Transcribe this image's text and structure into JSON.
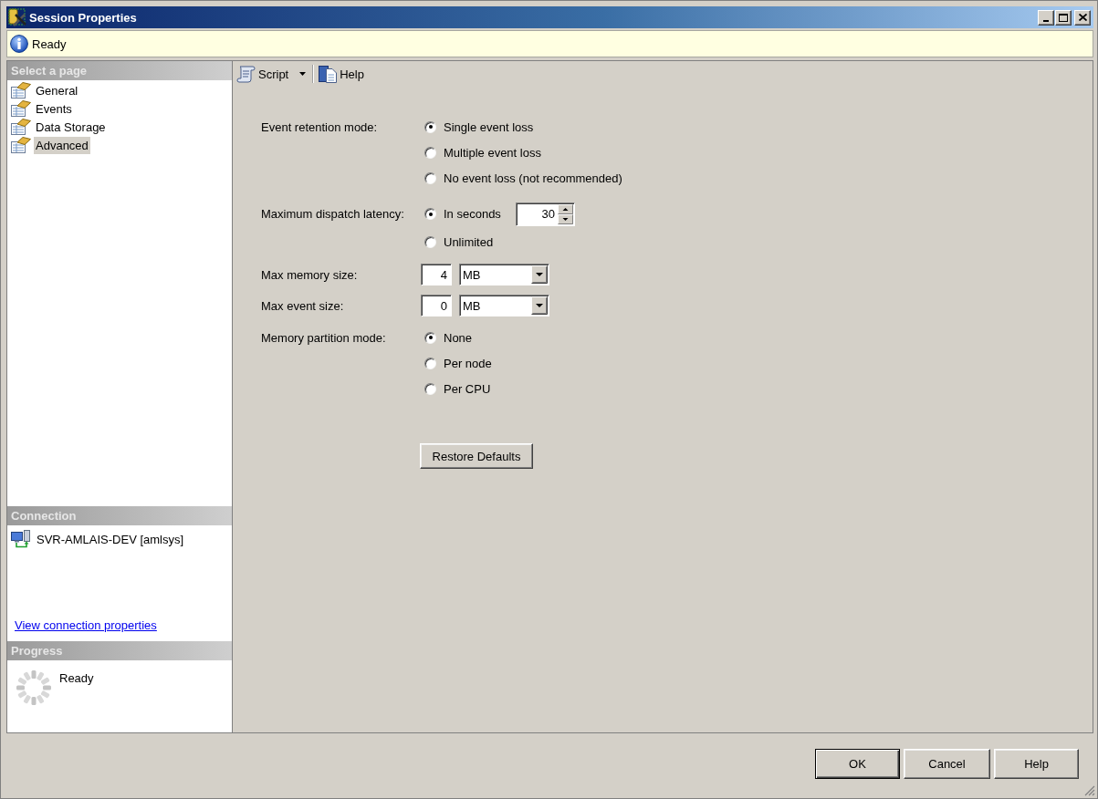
{
  "window": {
    "title": "Session Properties"
  },
  "status_bar": {
    "text": "Ready"
  },
  "sidebar": {
    "header": "Select a page",
    "items": [
      {
        "label": "General",
        "selected": false
      },
      {
        "label": "Events",
        "selected": false
      },
      {
        "label": "Data Storage",
        "selected": false
      },
      {
        "label": "Advanced",
        "selected": true
      }
    ]
  },
  "connection": {
    "header": "Connection",
    "server": "SVR-AMLAIS-DEV [amlsys]",
    "link": "View connection properties"
  },
  "progress": {
    "header": "Progress",
    "status": "Ready"
  },
  "toolbar": {
    "items": [
      {
        "label": "Script",
        "kind": "split"
      },
      {
        "label": "Help",
        "kind": "button"
      }
    ]
  },
  "form": {
    "rows": [
      {
        "kind": "radio",
        "label": "Event retention mode:",
        "options": [
          {
            "label": "Single event loss",
            "selected": true
          },
          {
            "label": "Multiple event loss",
            "selected": false
          },
          {
            "label": "No event loss (not recommended)",
            "selected": false
          }
        ]
      },
      {
        "kind": "radio",
        "label": "Maximum dispatch latency:",
        "options": [
          {
            "label": "In seconds",
            "selected": true,
            "spin_value": "30"
          },
          {
            "label": "Unlimited",
            "selected": false
          }
        ]
      },
      {
        "kind": "size",
        "label": "Max memory size:",
        "value": "4",
        "unit": "MB"
      },
      {
        "kind": "size",
        "label": "Max event size:",
        "value": "0",
        "unit": "MB"
      },
      {
        "kind": "radio",
        "label": "Memory partition mode:",
        "options": [
          {
            "label": "None",
            "selected": true
          },
          {
            "label": "Per node",
            "selected": false
          },
          {
            "label": "Per CPU",
            "selected": false
          }
        ]
      }
    ],
    "restore_button": "Restore Defaults"
  },
  "buttons": [
    {
      "label": "OK",
      "default": true
    },
    {
      "label": "Cancel",
      "default": false
    },
    {
      "label": "Help",
      "default": false
    }
  ]
}
